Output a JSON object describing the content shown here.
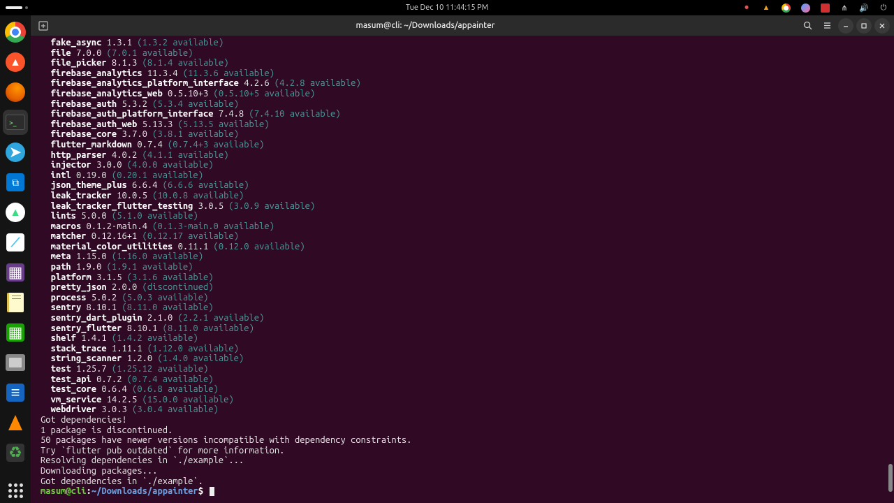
{
  "topbar": {
    "datetime": "Tue Dec 10  11:44:15 PM"
  },
  "window": {
    "title": "masum@cli: ~/Downloads/appainter"
  },
  "packages": [
    {
      "name": "fake_async",
      "ver": "1.3.1",
      "avail": "(1.3.2 available)"
    },
    {
      "name": "file",
      "ver": "7.0.0",
      "avail": "(7.0.1 available)"
    },
    {
      "name": "file_picker",
      "ver": "8.1.3",
      "avail": "(8.1.4 available)"
    },
    {
      "name": "firebase_analytics",
      "ver": "11.3.4",
      "avail": "(11.3.6 available)"
    },
    {
      "name": "firebase_analytics_platform_interface",
      "ver": "4.2.6",
      "avail": "(4.2.8 available)"
    },
    {
      "name": "firebase_analytics_web",
      "ver": "0.5.10+3",
      "avail": "(0.5.10+5 available)"
    },
    {
      "name": "firebase_auth",
      "ver": "5.3.2",
      "avail": "(5.3.4 available)"
    },
    {
      "name": "firebase_auth_platform_interface",
      "ver": "7.4.8",
      "avail": "(7.4.10 available)"
    },
    {
      "name": "firebase_auth_web",
      "ver": "5.13.3",
      "avail": "(5.13.5 available)"
    },
    {
      "name": "firebase_core",
      "ver": "3.7.0",
      "avail": "(3.8.1 available)"
    },
    {
      "name": "flutter_markdown",
      "ver": "0.7.4",
      "avail": "(0.7.4+3 available)"
    },
    {
      "name": "http_parser",
      "ver": "4.0.2",
      "avail": "(4.1.1 available)"
    },
    {
      "name": "injector",
      "ver": "3.0.0",
      "avail": "(4.0.0 available)"
    },
    {
      "name": "intl",
      "ver": "0.19.0",
      "avail": "(0.20.1 available)"
    },
    {
      "name": "json_theme_plus",
      "ver": "6.6.4",
      "avail": "(6.6.6 available)"
    },
    {
      "name": "leak_tracker",
      "ver": "10.0.5",
      "avail": "(10.0.8 available)"
    },
    {
      "name": "leak_tracker_flutter_testing",
      "ver": "3.0.5",
      "avail": "(3.0.9 available)"
    },
    {
      "name": "lints",
      "ver": "5.0.0",
      "avail": "(5.1.0 available)"
    },
    {
      "name": "macros",
      "ver": "0.1.2-main.4",
      "avail": "(0.1.3-main.0 available)"
    },
    {
      "name": "matcher",
      "ver": "0.12.16+1",
      "avail": "(0.12.17 available)"
    },
    {
      "name": "material_color_utilities",
      "ver": "0.11.1",
      "avail": "(0.12.0 available)"
    },
    {
      "name": "meta",
      "ver": "1.15.0",
      "avail": "(1.16.0 available)"
    },
    {
      "name": "path",
      "ver": "1.9.0",
      "avail": "(1.9.1 available)"
    },
    {
      "name": "platform",
      "ver": "3.1.5",
      "avail": "(3.1.6 available)"
    },
    {
      "name": "pretty_json",
      "ver": "2.0.0",
      "avail": "(discontinued)"
    },
    {
      "name": "process",
      "ver": "5.0.2",
      "avail": "(5.0.3 available)"
    },
    {
      "name": "sentry",
      "ver": "8.10.1",
      "avail": "(8.11.0 available)"
    },
    {
      "name": "sentry_dart_plugin",
      "ver": "2.1.0",
      "avail": "(2.2.1 available)"
    },
    {
      "name": "sentry_flutter",
      "ver": "8.10.1",
      "avail": "(8.11.0 available)"
    },
    {
      "name": "shelf",
      "ver": "1.4.1",
      "avail": "(1.4.2 available)"
    },
    {
      "name": "stack_trace",
      "ver": "1.11.1",
      "avail": "(1.12.0 available)"
    },
    {
      "name": "string_scanner",
      "ver": "1.2.0",
      "avail": "(1.4.0 available)"
    },
    {
      "name": "test",
      "ver": "1.25.7",
      "avail": "(1.25.12 available)"
    },
    {
      "name": "test_api",
      "ver": "0.7.2",
      "avail": "(0.7.4 available)"
    },
    {
      "name": "test_core",
      "ver": "0.6.4",
      "avail": "(0.6.8 available)"
    },
    {
      "name": "vm_service",
      "ver": "14.2.5",
      "avail": "(15.0.0 available)"
    },
    {
      "name": "webdriver",
      "ver": "3.0.3",
      "avail": "(3.0.4 available)"
    }
  ],
  "tail": [
    "Got dependencies!",
    "1 package is discontinued.",
    "50 packages have newer versions incompatible with dependency constraints.",
    "Try `flutter pub outdated` for more information.",
    "Resolving dependencies in `./example`...",
    "Downloading packages...",
    "Got dependencies in `./example`."
  ],
  "prompt": {
    "user": "masum@cli",
    "sep": ":",
    "path": "~/Downloads/appainter",
    "sym": "$"
  }
}
